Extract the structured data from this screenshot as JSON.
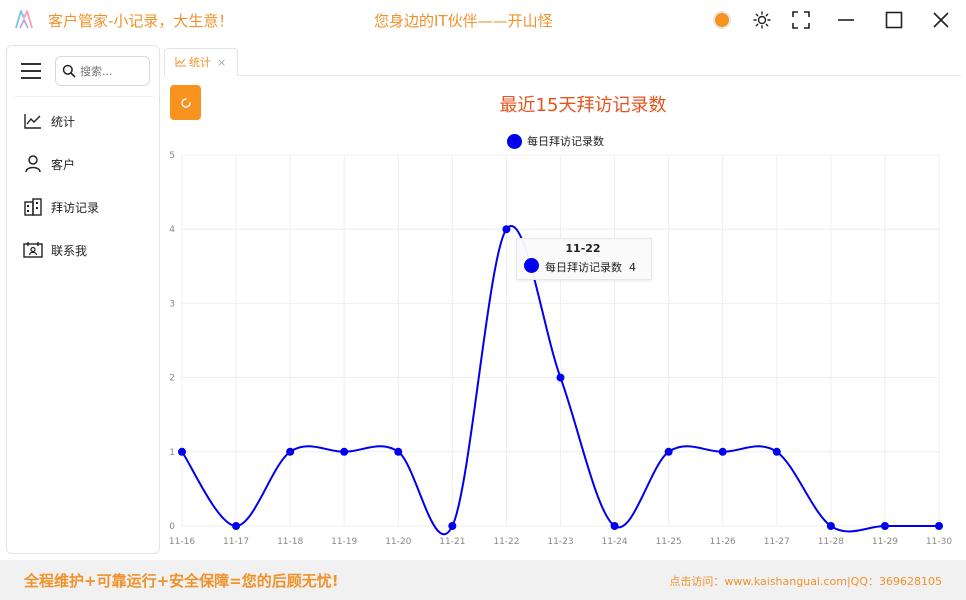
{
  "window": {
    "title": "客户管家-小记录，大生意！",
    "slogan": "您身边的IT伙伴——开山怪",
    "controls": [
      "theme",
      "brightness",
      "fullscreen",
      "minimize",
      "maximize",
      "close"
    ]
  },
  "sidebar": {
    "search_placeholder": "搜索...",
    "items": [
      {
        "label": "统计",
        "icon": "line-chart-icon"
      },
      {
        "label": "客户",
        "icon": "user-icon"
      },
      {
        "label": "拜访记录",
        "icon": "building-icon"
      },
      {
        "label": "联系我",
        "icon": "contact-card-icon"
      }
    ]
  },
  "tabs": [
    {
      "label": "统计",
      "icon": "line-chart-icon",
      "closable": true
    }
  ],
  "chart_data": {
    "type": "line",
    "title": "最近15天拜访记录数",
    "categories": [
      "11-16",
      "11-17",
      "11-18",
      "11-19",
      "11-20",
      "11-21",
      "11-22",
      "11-23",
      "11-24",
      "11-25",
      "11-26",
      "11-27",
      "11-28",
      "11-29",
      "11-30"
    ],
    "series": [
      {
        "name": "每日拜访记录数",
        "values": [
          1,
          0,
          1,
          1,
          1,
          0,
          4,
          2,
          0,
          1,
          1,
          1,
          0,
          0,
          0
        ],
        "color": "#0000ee"
      }
    ],
    "ylim": [
      0,
      5
    ],
    "yticks": [
      0,
      1,
      2,
      3,
      4,
      5
    ],
    "smooth": true,
    "grid": true,
    "legend": "top-center"
  },
  "tooltip": {
    "title": "11-22",
    "series_name": "每日拜访记录数",
    "value": "4"
  },
  "footer": {
    "left": "全程维护+可靠运行+安全保障=您的后顾无忧!",
    "right": "点击访问：www.kaishanguai.com|QQ：369628105"
  },
  "colors": {
    "accent": "#f7931e",
    "title": "#e8541e",
    "series": "#0000ee"
  }
}
